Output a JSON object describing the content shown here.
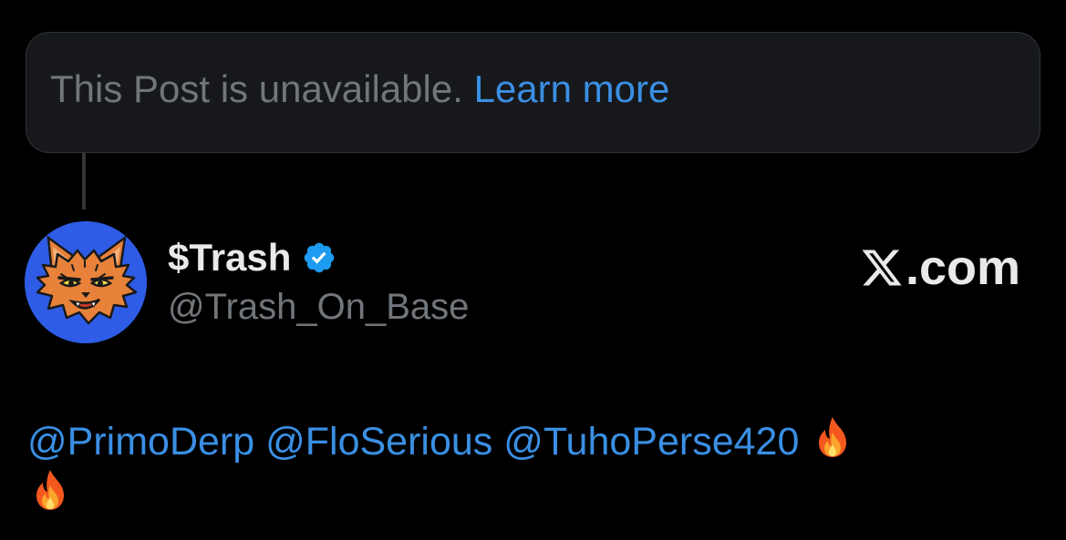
{
  "notice": {
    "text": "This Post is unavailable.",
    "link_label": "Learn more"
  },
  "author": {
    "display_name": "$Trash",
    "handle": "@Trash_On_Base",
    "verified": true,
    "avatar_icon": "cat-avatar-icon"
  },
  "brand": {
    "logo_icon": "x-logo-icon",
    "label": ".com"
  },
  "post": {
    "mentions": [
      "@PrimoDerp",
      "@FloSerious",
      "@TuhoPerse420"
    ],
    "emoji": [
      "fire-icon",
      "fire-icon"
    ]
  },
  "colors": {
    "background": "#000000",
    "notice_bg": "#16181c",
    "link": "#3a8fe3",
    "muted": "#71767b",
    "primary_text": "#e7e9ea",
    "verified": "#1d9bf0",
    "avatar_bg": "#2f5ce6"
  }
}
